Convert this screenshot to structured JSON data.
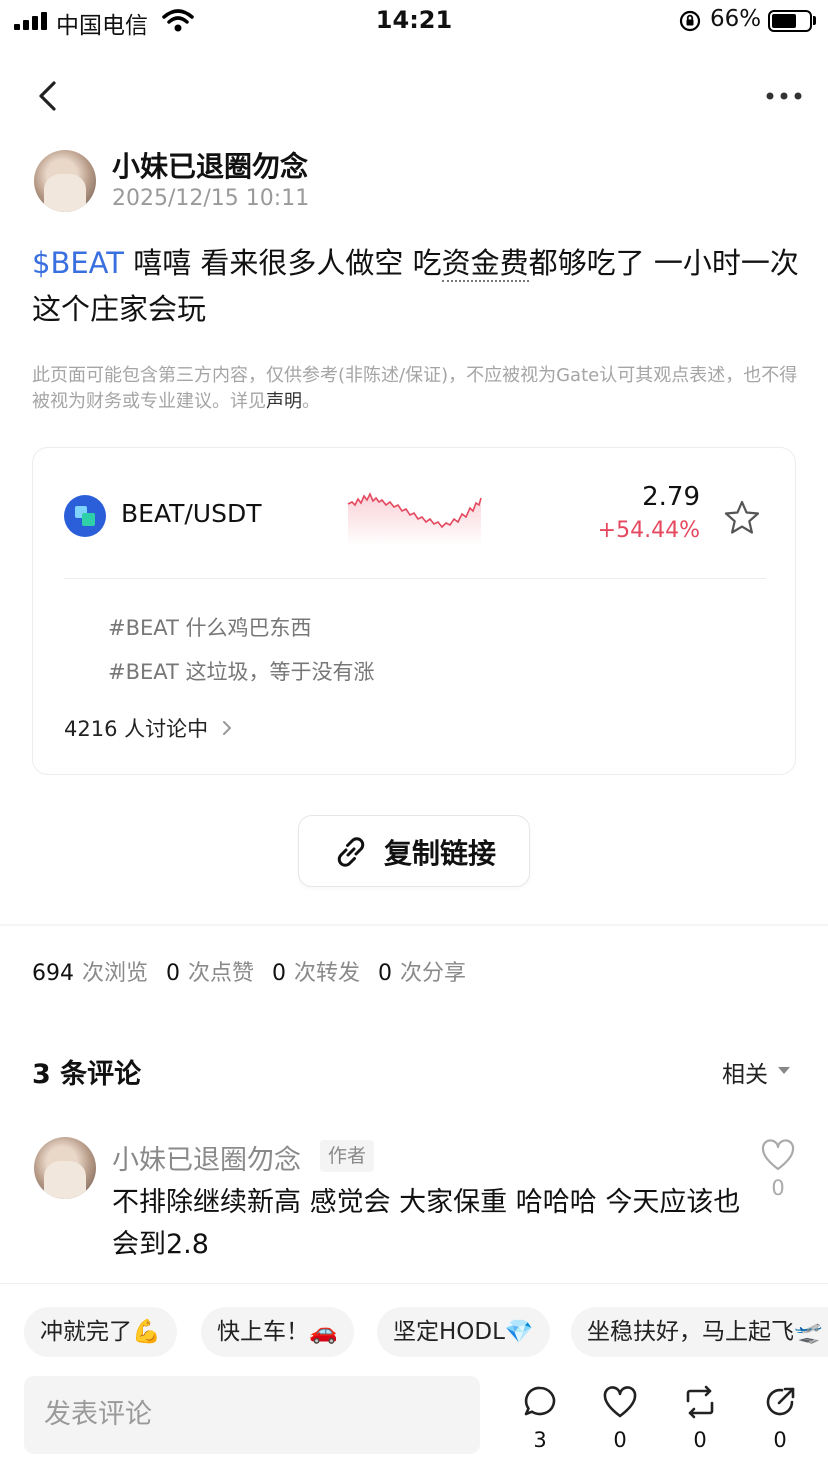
{
  "status_bar": {
    "carrier": "中国电信",
    "time": "14:21",
    "battery_pct": "66%",
    "battery_level": 0.66
  },
  "post": {
    "author": "小妹已退圈勿念",
    "time": "2025/12/15 10:11",
    "text_tag": "$BEAT",
    "text_a": " 嘻嘻 看来很多人做空 吃",
    "text_dotted": "资金费",
    "text_b": "都够吃了 一小时一次 这个庄家会玩",
    "disclaimer_text": "此页面可能包含第三方内容，仅供参考(非陈述/保证)，不应被视为Gate认可其观点表述，也不得被视为财务或专业建议。详见",
    "disclaimer_link": "声明",
    "disclaimer_end": "。"
  },
  "market_card": {
    "pair": "BEAT/USDT",
    "price": "2.79",
    "change": "+54.44%",
    "topics": [
      "#BEAT 什么鸡巴东西",
      "#BEAT 这垃圾，等于没有涨"
    ],
    "discussing": "4216 人讨论中",
    "accent_color": "#e5495f"
  },
  "copy_link": {
    "label": "复制链接"
  },
  "stats": [
    {
      "n": "694",
      "label": "次浏览"
    },
    {
      "n": "0",
      "label": "次点赞"
    },
    {
      "n": "0",
      "label": "次转发"
    },
    {
      "n": "0",
      "label": "次分享"
    }
  ],
  "comments": {
    "title": "3 条评论",
    "sort": "相关",
    "items": [
      {
        "author": "小妹已退圈勿念",
        "badge": "作者",
        "text": "不排除继续新高 感觉会 大家保重 哈哈哈 今天应该也会到2.8",
        "likes": "0"
      }
    ]
  },
  "quick_replies": [
    "冲就完了💪",
    "快上车！🚗",
    "坚定HODL💎",
    "坐稳扶好，马上起飞🛫"
  ],
  "input": {
    "placeholder": "发表评论"
  },
  "actions": [
    {
      "icon": "comment-icon",
      "count": "3"
    },
    {
      "icon": "like-icon",
      "count": "0"
    },
    {
      "icon": "repost-icon",
      "count": "0"
    },
    {
      "icon": "share-icon",
      "count": "0"
    }
  ]
}
